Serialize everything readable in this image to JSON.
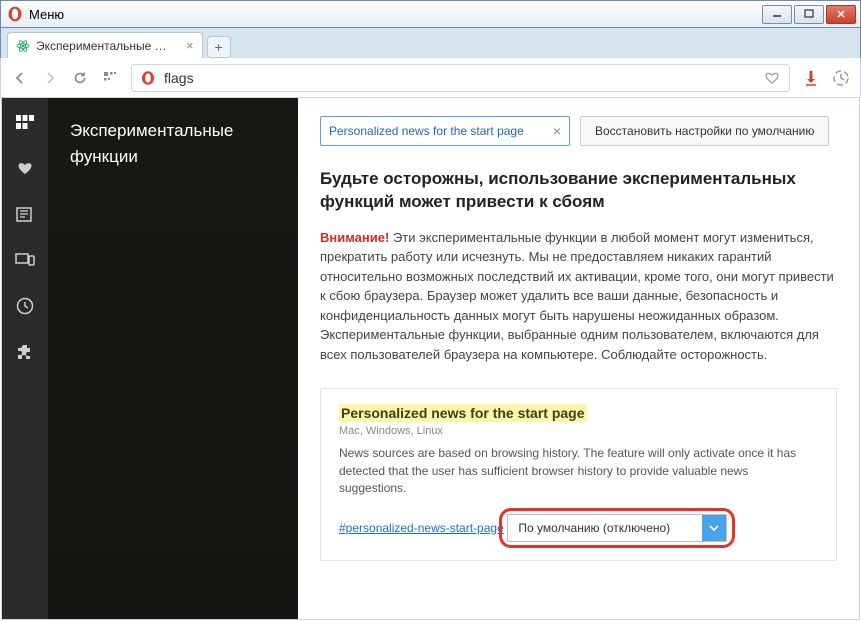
{
  "window": {
    "menu_label": "Меню"
  },
  "tab": {
    "title": "Экспериментальные фун"
  },
  "address": {
    "url": "flags"
  },
  "sidebar_panel": {
    "title": "Экспериментальные функции"
  },
  "search": {
    "value": "Personalized news for the start page",
    "restore_label": "Восстановить настройки по умолчанию"
  },
  "warning": {
    "title": "Будьте осторожны, использование экспериментальных функций может привести к сбоям",
    "attention_label": "Внимание!",
    "body": "Эти экспериментальные функции в любой момент могут измениться, прекратить работу или исчезнуть. Мы не предоставляем никаких гарантий относительно возможных последствий их активации, кроме того, они могут привести к сбою браузера. Браузер может удалить все ваши данные, безопасность и конфиденциальность данных могут быть нарушены неожиданных образом. Экспериментальные функции, выбранные одним пользователем, включаются для всех пользователей браузера на компьютере. Соблюдайте осторожность."
  },
  "flag": {
    "title": "Personalized news for the start page",
    "platforms": "Mac, Windows, Linux",
    "description": "News sources are based on browsing history. The feature will only activate once it has detected that the user has sufficient browser history to provide valuable news suggestions.",
    "anchor": "#personalized-news-start-page",
    "select_value": "По умолчанию (отключено)"
  }
}
